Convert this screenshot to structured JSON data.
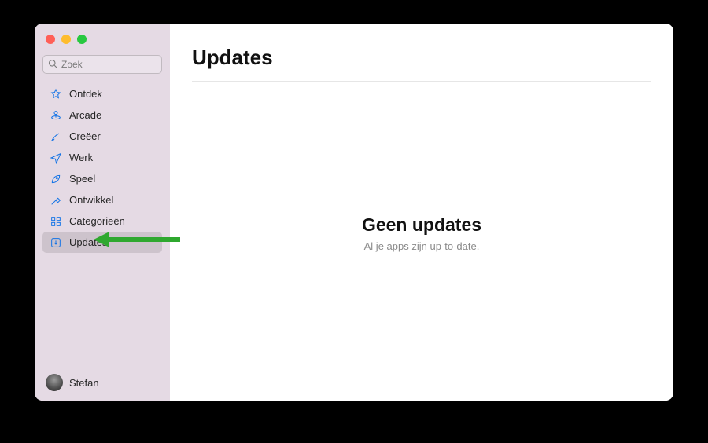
{
  "search": {
    "placeholder": "Zoek"
  },
  "sidebar": {
    "items": [
      {
        "label": "Ontdek"
      },
      {
        "label": "Arcade"
      },
      {
        "label": "Creëer"
      },
      {
        "label": "Werk"
      },
      {
        "label": "Speel"
      },
      {
        "label": "Ontwikkel"
      },
      {
        "label": "Categorieën"
      },
      {
        "label": "Updates"
      }
    ]
  },
  "user": {
    "name": "Stefan"
  },
  "main": {
    "title": "Updates",
    "empty_title": "Geen updates",
    "empty_subtitle": "Al je apps zijn up-to-date."
  },
  "colors": {
    "accent": "#1273e6",
    "annotation": "#2fa82f"
  }
}
